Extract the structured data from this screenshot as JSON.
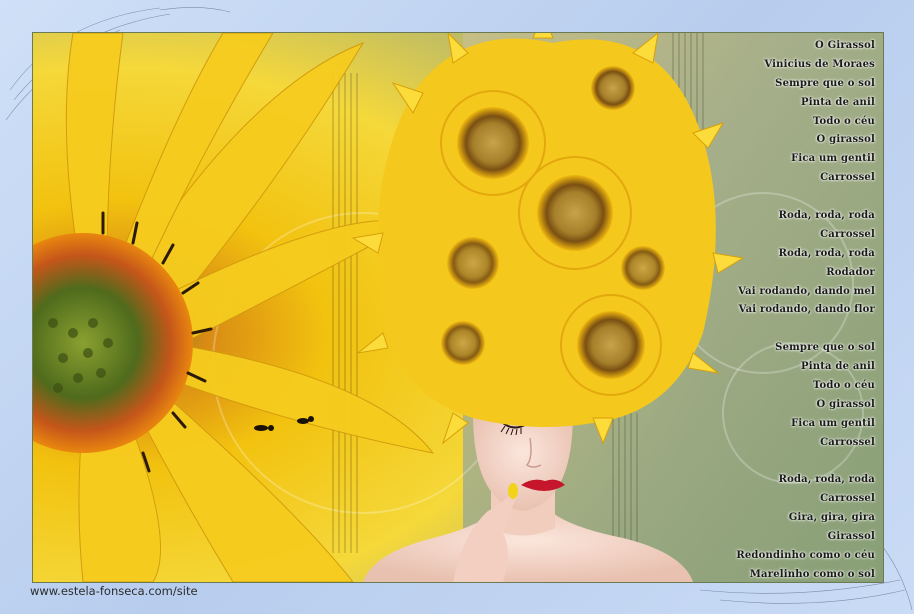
{
  "image": {
    "subject": "woman-with-sunflower-headpiece",
    "colors": {
      "frame": "#bcd3f0",
      "petal": "#f4c81c",
      "petal_dark": "#e2a30f",
      "flower_center": "#9a7b2c",
      "lips": "#c6162b",
      "skin": "#f3d6c9"
    }
  },
  "poem": {
    "lines": [
      "O Girassol",
      "Vinicius de Moraes",
      "Sempre que o sol",
      "Pinta de anil",
      "Todo o céu",
      "O girassol",
      "Fica um gentil",
      "Carrossel",
      "",
      "Roda, roda, roda",
      "Carrossel",
      "Roda, roda, roda",
      "Rodador",
      "Vai rodando, dando mel",
      "Vai rodando, dando flor",
      "",
      "Sempre que o sol",
      "Pinta de anil",
      "Todo o céu",
      "O girassol",
      "Fica um gentil",
      "Carrossel",
      "",
      "Roda, roda, roda",
      "Carrossel",
      "Gira, gira, gira",
      "Girassol",
      "Redondinho como o céu",
      "Marelinho como o sol"
    ]
  },
  "watermark": {
    "text": "www.estela-fonseca.com/site"
  }
}
